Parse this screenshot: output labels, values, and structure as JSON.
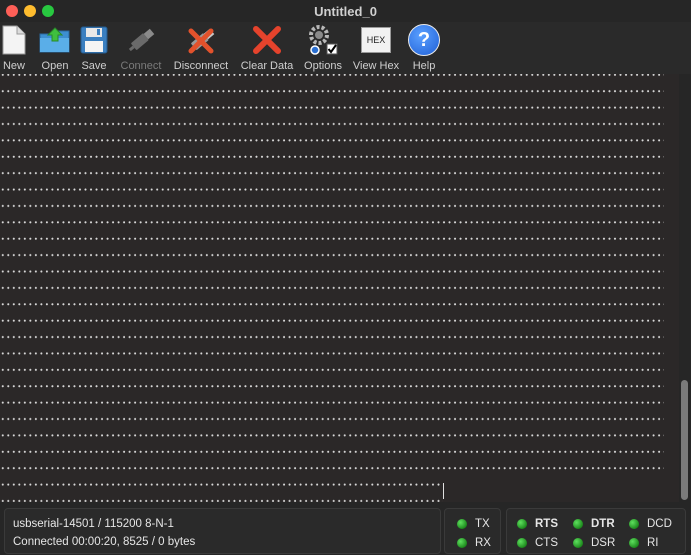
{
  "window": {
    "title": "Untitled_0"
  },
  "toolbar": {
    "items": [
      {
        "label": "New",
        "icon": "new-document-icon",
        "enabled": true
      },
      {
        "label": "Open",
        "icon": "open-folder-icon",
        "enabled": true
      },
      {
        "label": "Save",
        "icon": "floppy-disk-icon",
        "enabled": true
      },
      {
        "label": "Connect",
        "icon": "usb-plug-icon",
        "enabled": false
      },
      {
        "label": "Disconnect",
        "icon": "disconnect-plug-icon",
        "enabled": true
      },
      {
        "label": "Clear Data",
        "icon": "red-x-icon",
        "enabled": true
      },
      {
        "label": "Options",
        "icon": "gears-icon",
        "enabled": true
      },
      {
        "label": "View Hex",
        "icon": "hex-icon",
        "hex_text": "HEX",
        "enabled": true
      },
      {
        "label": "Help",
        "icon": "question-mark-icon",
        "help_glyph": "?",
        "enabled": true
      }
    ]
  },
  "status": {
    "port_line": "usbserial-14501 / 115200 8-N-1",
    "connection_line": "Connected 00:00:20, 8525 / 0 bytes"
  },
  "signals": {
    "tx": "TX",
    "rx": "RX",
    "rts": "RTS",
    "cts": "CTS",
    "dtr": "DTR",
    "dsr": "DSR",
    "dcd": "DCD",
    "ri": "RI"
  },
  "colors": {
    "terminal_bg": "#2b2828",
    "led_on": "#3cc43c",
    "close": "#fe5f57",
    "minimize": "#febc2e",
    "maximize": "#28c840"
  }
}
